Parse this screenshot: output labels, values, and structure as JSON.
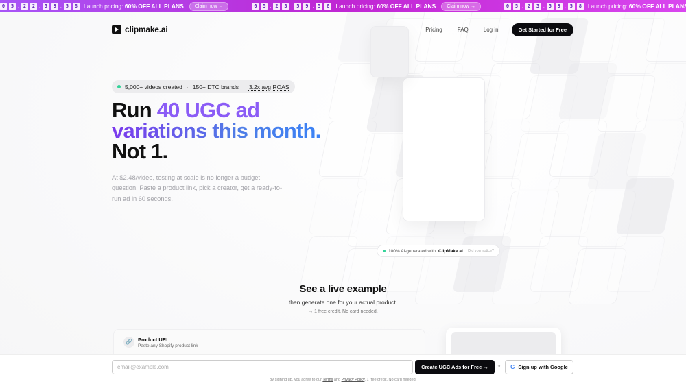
{
  "banner": {
    "promos": [
      {
        "digits_a": [
          "0",
          "5"
        ],
        "digits_b": [
          "2",
          "2"
        ],
        "digits_c": [
          "5",
          "9"
        ],
        "digits_d": [
          "5",
          "8"
        ]
      },
      {
        "digits_a": [
          "0",
          "5"
        ],
        "digits_b": [
          "2",
          "3"
        ],
        "digits_c": [
          "5",
          "9"
        ],
        "digits_d": [
          "5",
          "8"
        ]
      },
      {
        "digits_a": [
          "0",
          "5"
        ],
        "digits_b": [
          "2",
          "3"
        ],
        "digits_c": [
          "5",
          "9"
        ],
        "digits_d": [
          "5",
          "8"
        ]
      }
    ],
    "text_prefix": "Launch pricing:",
    "text_bold": "60% OFF ALL PLANS",
    "claim_label": "Claim now →"
  },
  "nav": {
    "logo": "clipmake.ai",
    "links": [
      "Pricing",
      "FAQ",
      "Log in"
    ],
    "cta": "Get Started for Free"
  },
  "hero": {
    "stats": [
      "5,000+ videos created",
      "150+ DTC brands",
      "3.2x avg ROAS"
    ],
    "headline_run": "Run ",
    "headline_accent1": "40 UGC ad",
    "headline_accent2": "variations this month.",
    "headline_line3": "Not 1.",
    "subtitle": "At $2.48/video, testing at scale is no longer a budget question. Paste a product link, pick a creator, get a ready-to-run ad in 60 seconds."
  },
  "ai_badge": {
    "prefix": "100% AI-generated with",
    "brand": "ClipMake.ai",
    "suffix": "· Did you notice?"
  },
  "live_example": {
    "title": "See a live example",
    "subtitle": "then generate one for your actual product.",
    "note": "→ 1 free credit. No card needed."
  },
  "product_card": {
    "title": "Product URL",
    "subtitle": "Paste any Shopify product link"
  },
  "footer": {
    "email_placeholder": "email@example.com",
    "create_label": "Create UGC Ads for Free →",
    "or_label": "or",
    "google_label": "Sign up with Google",
    "terms_prefix": "By signing up, you agree to our",
    "terms_link": "Terms",
    "and": "and",
    "privacy_link": "Privacy Policy",
    "terms_suffix": ". 1 free credit. No card needed."
  },
  "colors": {
    "banner_gradient_start": "#a855f7",
    "banner_gradient_end": "#d946ef",
    "accent_purple": "#8b5cf6",
    "accent_blue": "#3b82f6",
    "cta_black": "#0b0b0f"
  }
}
